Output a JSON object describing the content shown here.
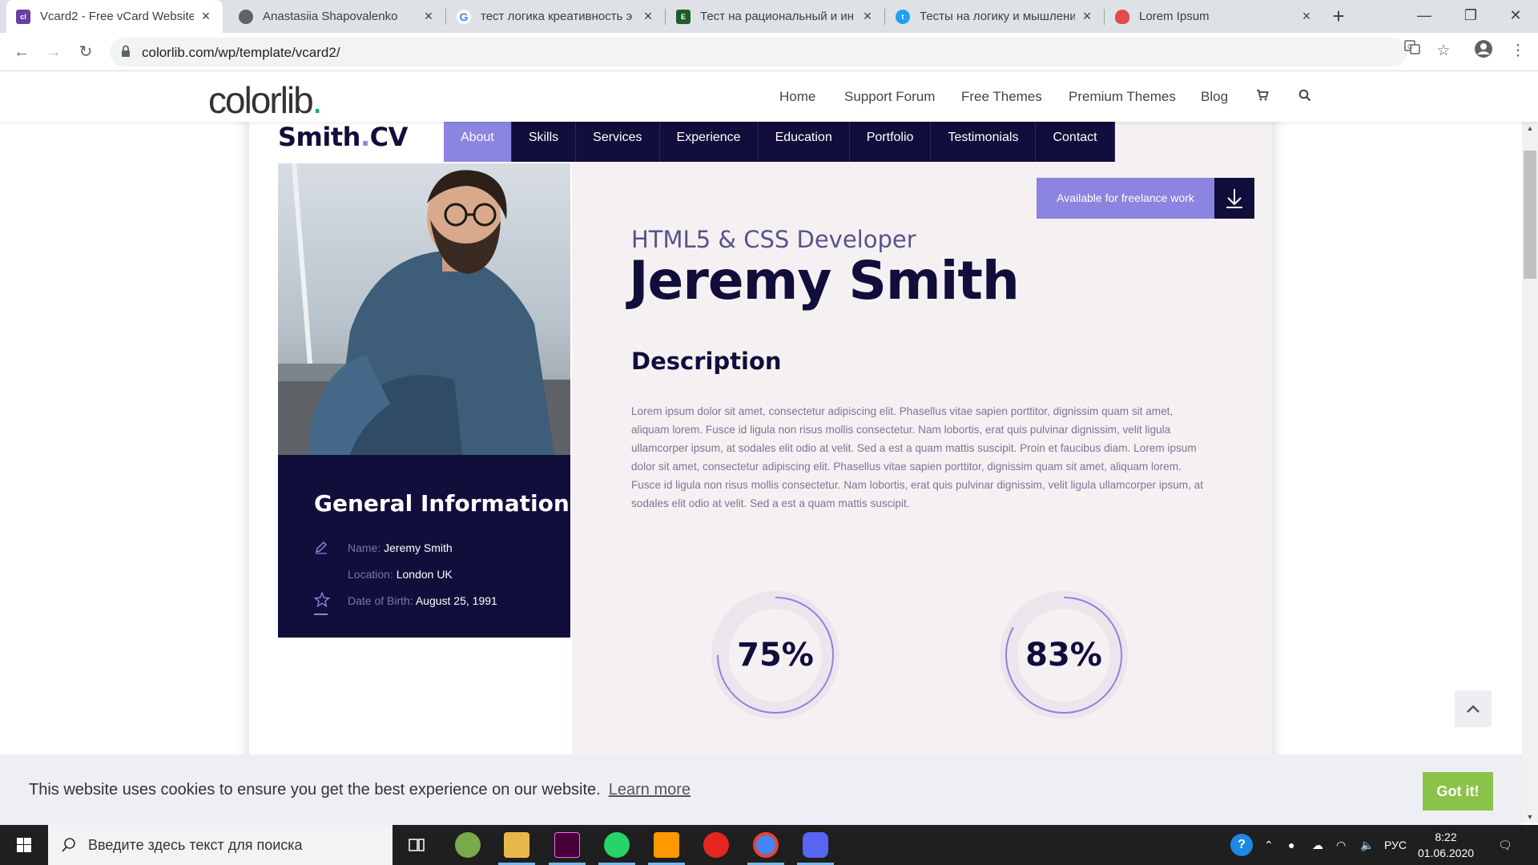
{
  "browser": {
    "tabs": [
      {
        "title": "Vcard2 - Free vCard Website",
        "favicon_color": "#6b3fa0",
        "favicon_text": "colorlib",
        "active": true
      },
      {
        "title": "Anastasiia Shapovalenko",
        "favicon_color": "#5f6368"
      },
      {
        "title": "тест логика креативность э",
        "favicon_color": "#4285f4"
      },
      {
        "title": "Тест на рациональный и ин",
        "favicon_color": "#1e5d2a"
      },
      {
        "title": "Тесты на логику и мышлени",
        "favicon_color": "#1da1f2"
      },
      {
        "title": "Lorem Ipsum",
        "favicon_color": "#e24b4b"
      }
    ],
    "url": "colorlib.com/wp/template/vcard2/"
  },
  "colorlib": {
    "logo": "colorlib",
    "logo_dot": ".",
    "nav": [
      "Home",
      "Support Forum",
      "Free Themes",
      "Premium Themes",
      "Blog"
    ]
  },
  "cv": {
    "logo_main": "Smith",
    "logo_dot": ".",
    "logo_suffix": "CV",
    "nav": [
      "About",
      "Skills",
      "Services",
      "Experience",
      "Education",
      "Portfolio",
      "Testimonials",
      "Contact"
    ],
    "active_nav": "About",
    "freelance_label": "Available for freelance work",
    "role": "HTML5 & CSS Developer",
    "name": "Jeremy Smith",
    "description_heading": "Description",
    "description": "Lorem ipsum dolor sit amet, consectetur adipiscing elit. Phasellus vitae sapien porttitor, dignissim quam sit amet, aliquam lorem. Fusce id ligula non risus mollis consectetur. Nam lobortis, erat quis pulvinar dignissim, velit ligula ullamcorper ipsum, at sodales elit odio at velit. Sed a est a quam mattis suscipit. Proin et faucibus diam. Lorem ipsum dolor sit amet, consectetur adipiscing elit. Phasellus vitae sapien porttitor, dignissim quam sit amet, aliquam lorem. Fusce id ligula non risus mollis consectetur. Nam lobortis, erat quis pulvinar dignissim, velit ligula ullamcorper ipsum, at sodales elit odio at velit. Sed a est a quam mattis suscipit.",
    "general_info": {
      "heading": "General Information",
      "name_label": "Name:",
      "name_value": "Jeremy Smith",
      "location_label": "Location:",
      "location_value": "London UK",
      "dob_label": "Date of Birth:",
      "dob_value": "August 25, 1991"
    },
    "skills": [
      {
        "label": "75%",
        "value": 0.75
      },
      {
        "label": "83%",
        "value": 0.83
      }
    ],
    "colors": {
      "navy": "#120e3b",
      "accent": "#8b84e0",
      "background": "#f5f0f2"
    }
  },
  "cookie": {
    "message": "This website uses cookies to ensure you get the best experience on our website.",
    "learn_more": "Learn more",
    "button": "Got it!"
  },
  "taskbar": {
    "search_placeholder": "Введите здесь текст для поиска",
    "lang": "РУС",
    "time": "8:22",
    "date": "01.06.2020"
  }
}
